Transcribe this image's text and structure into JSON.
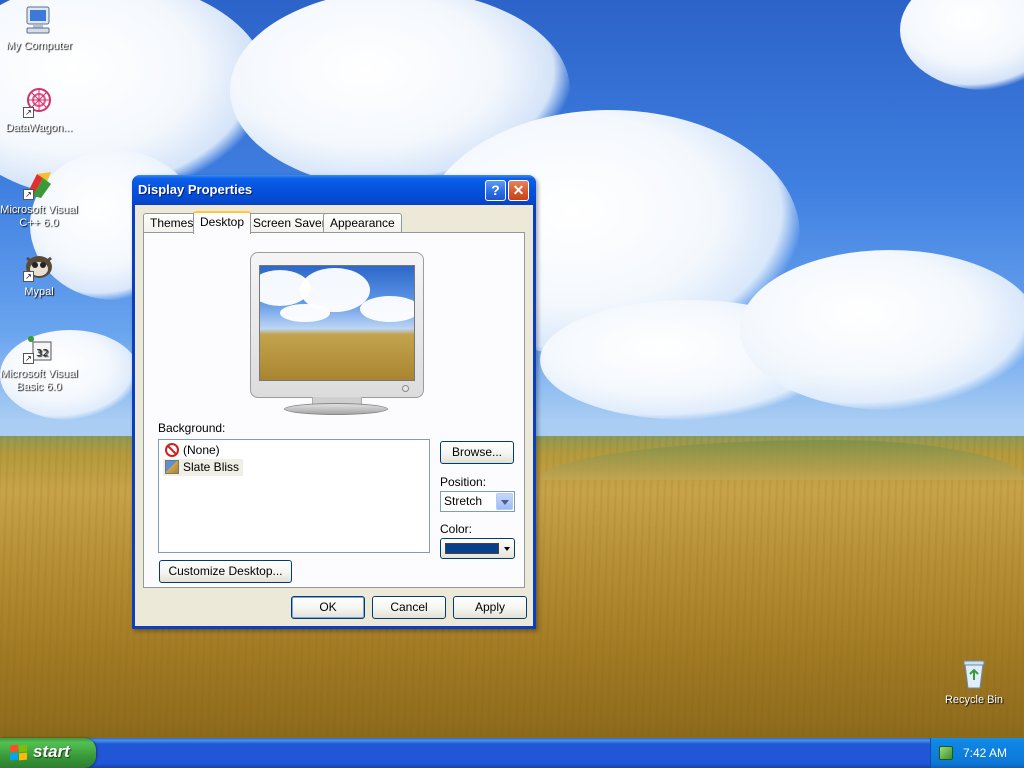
{
  "desktop": {
    "icons": [
      {
        "label": "My Computer",
        "icon": "my-computer-icon"
      },
      {
        "label": "DataWagon...",
        "icon": "datawagon-icon"
      },
      {
        "label": "Microsoft Visual C++ 6.0",
        "icon": "visual-cpp-icon"
      },
      {
        "label": "Mypal",
        "icon": "mypal-icon"
      },
      {
        "label": "Microsoft Visual Basic 6.0",
        "icon": "visual-basic-icon"
      },
      {
        "label": "Recycle Bin",
        "icon": "recycle-bin-icon"
      }
    ]
  },
  "dialog": {
    "title": "Display Properties",
    "help_glyph": "?",
    "close_glyph": "✕",
    "tabs": [
      {
        "label": "Themes"
      },
      {
        "label": "Desktop"
      },
      {
        "label": "Screen Saver"
      },
      {
        "label": "Appearance"
      }
    ],
    "active_tab": "Desktop",
    "background_label": "Background:",
    "backgrounds": [
      {
        "label": "(None)",
        "icon": "none-icon"
      },
      {
        "label": "Slate Bliss",
        "icon": "image-file-icon"
      }
    ],
    "selected_background": "Slate Bliss",
    "browse_label": "Browse...",
    "position_label": "Position:",
    "position_value": "Stretch",
    "color_label": "Color:",
    "color_value": "#0a3f8c",
    "customize_label": "Customize Desktop...",
    "ok_label": "OK",
    "cancel_label": "Cancel",
    "apply_label": "Apply"
  },
  "taskbar": {
    "start_label": "start",
    "clock": "7:42 AM"
  },
  "colors": {
    "title_bar": "#0552dd",
    "dialog_bg": "#ece9d8",
    "taskbar": "#2157d7",
    "start_button": "#3a9a3a"
  }
}
